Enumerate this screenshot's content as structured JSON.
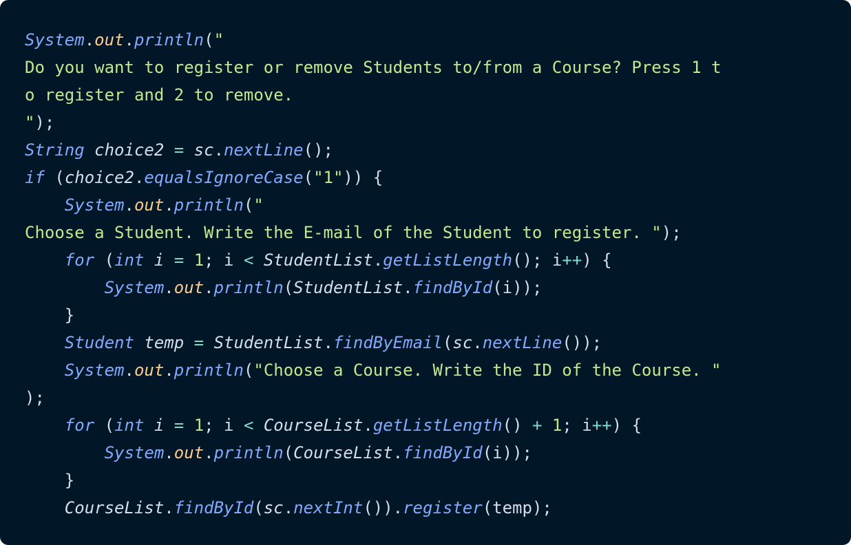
{
  "editor": {
    "background": "#011627",
    "colors": {
      "type": "#82aaff",
      "property": "#ffcb8b",
      "string": "#c3e88d",
      "operator": "#7fdbca",
      "plain": "#d6deeb"
    },
    "lines": [
      [
        [
          "type",
          "System"
        ],
        [
          "punc",
          "."
        ],
        [
          "prop",
          "out"
        ],
        [
          "punc",
          "."
        ],
        [
          "fn",
          "println"
        ],
        [
          "punc",
          "("
        ],
        [
          "str",
          "\""
        ]
      ],
      [
        [
          "str",
          "Do you want to register or remove Students to/from a Course? Press 1 t"
        ]
      ],
      [
        [
          "str",
          "o register and 2 to remove."
        ]
      ],
      [
        [
          "str",
          "\""
        ],
        [
          "punc",
          ");"
        ]
      ],
      [
        [
          "type",
          "String"
        ],
        [
          "plain",
          " "
        ],
        [
          "var",
          "choice2"
        ],
        [
          "plain",
          " "
        ],
        [
          "op",
          "="
        ],
        [
          "plain",
          " "
        ],
        [
          "id",
          "sc"
        ],
        [
          "punc",
          "."
        ],
        [
          "fn",
          "nextLine"
        ],
        [
          "punc",
          "();"
        ]
      ],
      [
        [
          "kw",
          "if"
        ],
        [
          "plain",
          " ("
        ],
        [
          "id",
          "choice2"
        ],
        [
          "punc",
          "."
        ],
        [
          "fn",
          "equalsIgnoreCase"
        ],
        [
          "punc",
          "("
        ],
        [
          "str",
          "\"1\""
        ],
        [
          "punc",
          ")) {"
        ]
      ],
      [
        [
          "plain",
          "    "
        ],
        [
          "type",
          "System"
        ],
        [
          "punc",
          "."
        ],
        [
          "prop",
          "out"
        ],
        [
          "punc",
          "."
        ],
        [
          "fn",
          "println"
        ],
        [
          "punc",
          "("
        ],
        [
          "str",
          "\""
        ]
      ],
      [
        [
          "str",
          "Choose a Student. Write the E-mail of the Student to register. \""
        ],
        [
          "punc",
          ");"
        ]
      ],
      [
        [
          "plain",
          "    "
        ],
        [
          "kw",
          "for"
        ],
        [
          "plain",
          " ("
        ],
        [
          "kw",
          "int"
        ],
        [
          "plain",
          " "
        ],
        [
          "var",
          "i"
        ],
        [
          "plain",
          " "
        ],
        [
          "op",
          "="
        ],
        [
          "plain",
          " "
        ],
        [
          "num",
          "1"
        ],
        [
          "punc",
          ";"
        ],
        [
          "plain",
          " i "
        ],
        [
          "op",
          "<"
        ],
        [
          "plain",
          " "
        ],
        [
          "id",
          "StudentList"
        ],
        [
          "punc",
          "."
        ],
        [
          "fn",
          "getListLength"
        ],
        [
          "punc",
          "();"
        ],
        [
          "plain",
          " i"
        ],
        [
          "op",
          "++"
        ],
        [
          "punc",
          ") {"
        ]
      ],
      [
        [
          "plain",
          "        "
        ],
        [
          "type",
          "System"
        ],
        [
          "punc",
          "."
        ],
        [
          "prop",
          "out"
        ],
        [
          "punc",
          "."
        ],
        [
          "fn",
          "println"
        ],
        [
          "punc",
          "("
        ],
        [
          "id",
          "StudentList"
        ],
        [
          "punc",
          "."
        ],
        [
          "fn",
          "findById"
        ],
        [
          "punc",
          "(i));"
        ]
      ],
      [
        [
          "plain",
          "    "
        ],
        [
          "punc",
          "}"
        ]
      ],
      [
        [
          "plain",
          "    "
        ],
        [
          "type",
          "Student"
        ],
        [
          "plain",
          " "
        ],
        [
          "var",
          "temp"
        ],
        [
          "plain",
          " "
        ],
        [
          "op",
          "="
        ],
        [
          "plain",
          " "
        ],
        [
          "id",
          "StudentList"
        ],
        [
          "punc",
          "."
        ],
        [
          "fn",
          "findByEmail"
        ],
        [
          "punc",
          "("
        ],
        [
          "id",
          "sc"
        ],
        [
          "punc",
          "."
        ],
        [
          "fn",
          "nextLine"
        ],
        [
          "punc",
          "());"
        ]
      ],
      [
        [
          "plain",
          "    "
        ],
        [
          "type",
          "System"
        ],
        [
          "punc",
          "."
        ],
        [
          "prop",
          "out"
        ],
        [
          "punc",
          "."
        ],
        [
          "fn",
          "println"
        ],
        [
          "punc",
          "("
        ],
        [
          "str",
          "\"Choose a Course. Write the ID of the Course. \""
        ]
      ],
      [
        [
          "punc",
          ");"
        ]
      ],
      [
        [
          "plain",
          "    "
        ],
        [
          "kw",
          "for"
        ],
        [
          "plain",
          " ("
        ],
        [
          "kw",
          "int"
        ],
        [
          "plain",
          " "
        ],
        [
          "var",
          "i"
        ],
        [
          "plain",
          " "
        ],
        [
          "op",
          "="
        ],
        [
          "plain",
          " "
        ],
        [
          "num",
          "1"
        ],
        [
          "punc",
          ";"
        ],
        [
          "plain",
          " i "
        ],
        [
          "op",
          "<"
        ],
        [
          "plain",
          " "
        ],
        [
          "id",
          "CourseList"
        ],
        [
          "punc",
          "."
        ],
        [
          "fn",
          "getListLength"
        ],
        [
          "punc",
          "()"
        ],
        [
          "plain",
          " "
        ],
        [
          "op",
          "+"
        ],
        [
          "plain",
          " "
        ],
        [
          "num",
          "1"
        ],
        [
          "punc",
          ";"
        ],
        [
          "plain",
          " i"
        ],
        [
          "op",
          "++"
        ],
        [
          "punc",
          ") {"
        ]
      ],
      [
        [
          "plain",
          "        "
        ],
        [
          "type",
          "System"
        ],
        [
          "punc",
          "."
        ],
        [
          "prop",
          "out"
        ],
        [
          "punc",
          "."
        ],
        [
          "fn",
          "println"
        ],
        [
          "punc",
          "("
        ],
        [
          "id",
          "CourseList"
        ],
        [
          "punc",
          "."
        ],
        [
          "fn",
          "findById"
        ],
        [
          "punc",
          "(i));"
        ]
      ],
      [
        [
          "plain",
          "    "
        ],
        [
          "punc",
          "}"
        ]
      ],
      [
        [
          "plain",
          "    "
        ],
        [
          "id",
          "CourseList"
        ],
        [
          "punc",
          "."
        ],
        [
          "fn",
          "findById"
        ],
        [
          "punc",
          "("
        ],
        [
          "id",
          "sc"
        ],
        [
          "punc",
          "."
        ],
        [
          "fn",
          "nextInt"
        ],
        [
          "punc",
          "())."
        ],
        [
          "fn",
          "register"
        ],
        [
          "punc",
          "(temp);"
        ]
      ]
    ]
  }
}
